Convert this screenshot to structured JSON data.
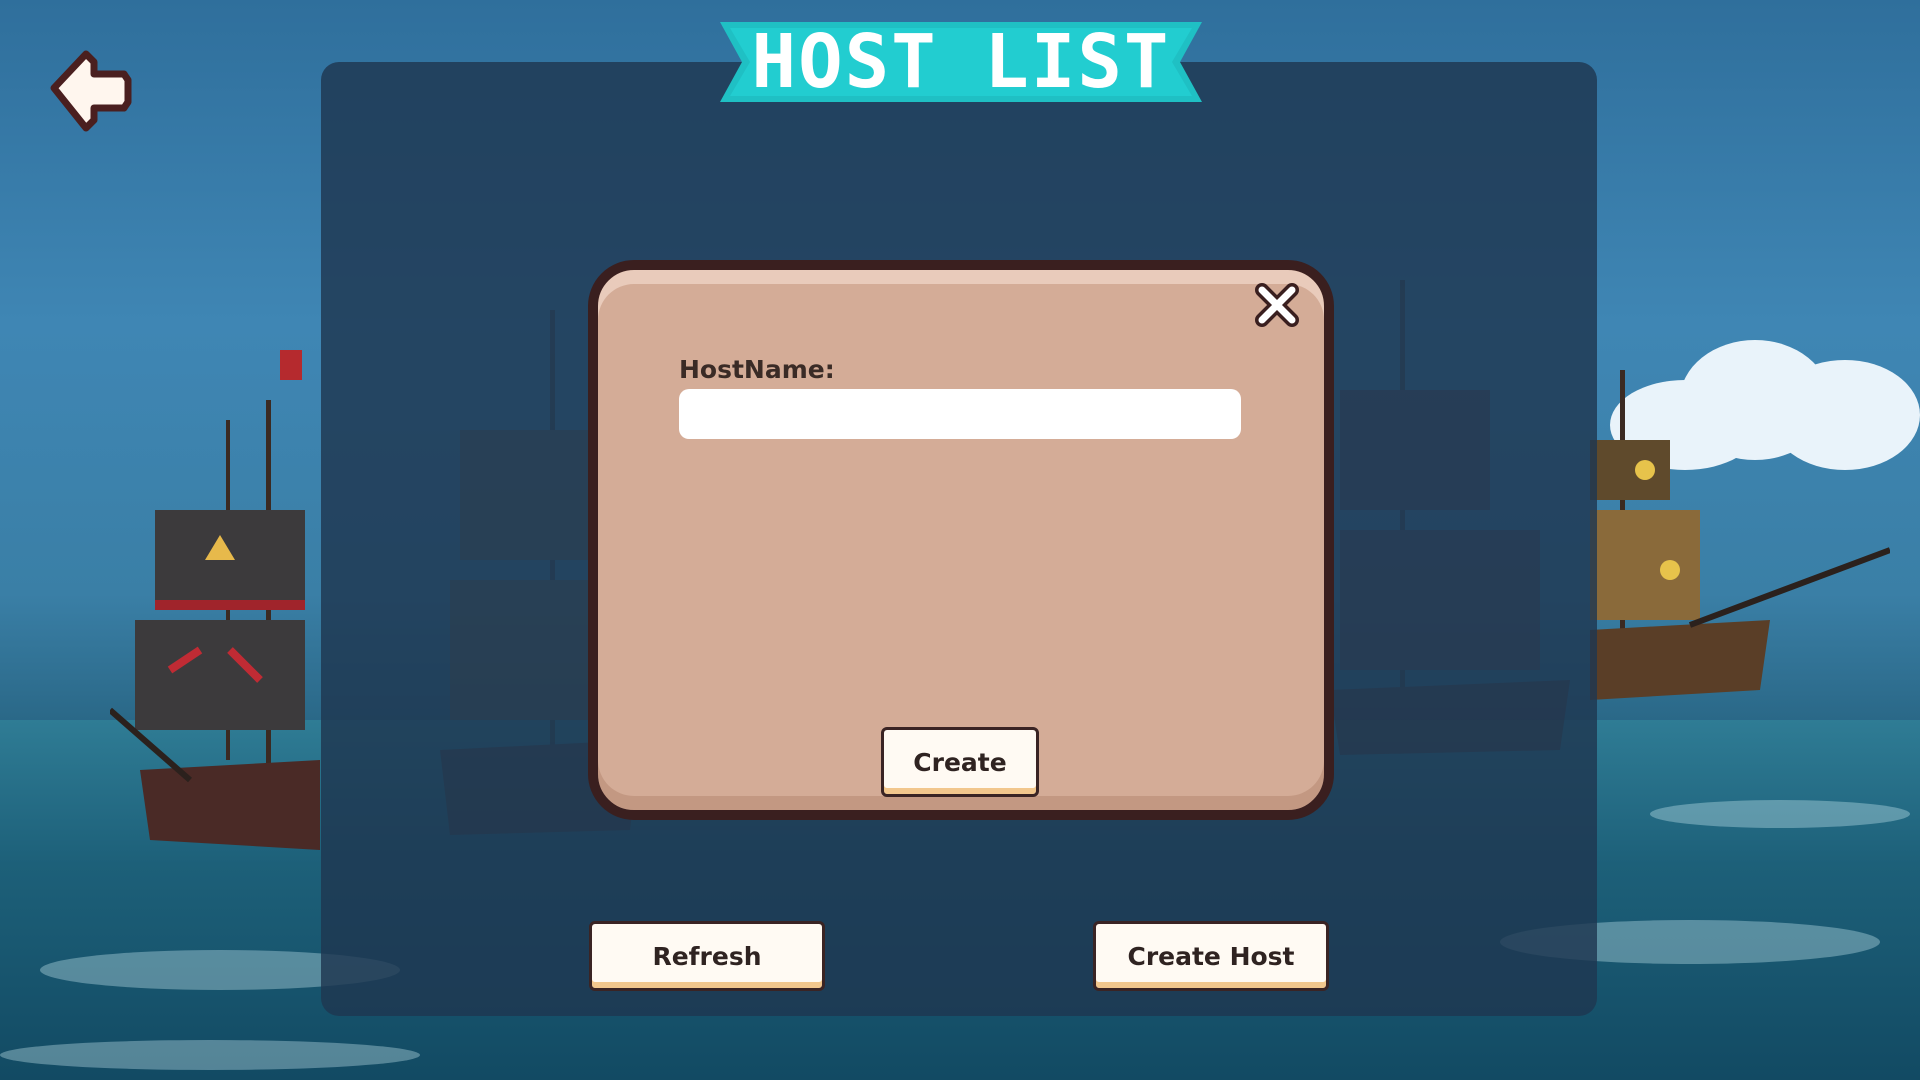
{
  "header": {
    "title": "HOST LIST",
    "back_icon": "back-arrow-icon"
  },
  "dialog": {
    "close_icon": "close-icon",
    "host_name_label": "HostName:",
    "host_name_value": "",
    "host_name_placeholder": "",
    "create_label": "Create"
  },
  "footer": {
    "refresh_label": "Refresh",
    "create_host_label": "Create Host"
  },
  "colors": {
    "banner": "#1fc0c4",
    "panel": "#1e3750",
    "modal": "#d4ac97",
    "modal_border": "#3a1f1f",
    "button_face": "#fffaf3",
    "button_shadow": "#f2c78d"
  }
}
